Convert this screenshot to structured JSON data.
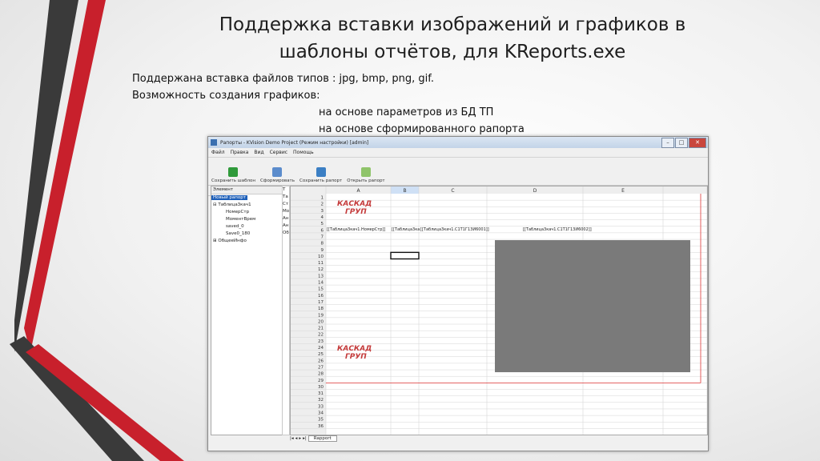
{
  "slide": {
    "title_line1": "Поддержка вставки изображений и графиков в",
    "title_line2": "шаблоны отчётов, для KReports.exe",
    "body_line1": "Поддержана вставка файлов типов : jpg, bmp, png, gif.",
    "body_line2": "Возможность создания графиков:",
    "body_line3": "на основе параметров из БД ТП",
    "body_line4": "на основе сформированного рапорта",
    "colors": {
      "accent_red": "#c8202c",
      "accent_gray": "#3a3a3a"
    }
  },
  "window": {
    "title": "Рапорты - KVision Demo Project (Режим настройки) [admin]",
    "controls": {
      "minimize": "–",
      "maximize": "□",
      "close": "✕"
    },
    "menu": [
      "Файл",
      "Правка",
      "Вид",
      "Сервис",
      "Помощь"
    ],
    "big_toolbar": [
      {
        "label": "Сохранить шаблон",
        "icon": "save-icon"
      },
      {
        "label": "Сформировать",
        "icon": "generate-icon"
      },
      {
        "label": "Сохранить рапорт",
        "icon": "save-report-icon"
      },
      {
        "label": "Открыть рапорт",
        "icon": "open-report-icon"
      }
    ],
    "tree_header": "Элемент",
    "tree_selected": "Новый рапорт",
    "tree_items": [
      "Таблица3кач1",
      "НомерСтр",
      "МоментВрем",
      "saved_0",
      "Save0_180",
      "ОбщееИнфо"
    ],
    "type_header": "Т",
    "type_items": [
      "Та",
      "Ст",
      "Мо",
      "Ан",
      "Ан",
      "Об"
    ],
    "columns": [
      "A",
      "B",
      "C",
      "D",
      "E"
    ],
    "row_numbers": [
      "1",
      "2",
      "3",
      "4",
      "5",
      "6",
      "7",
      "8",
      "9",
      "10",
      "11",
      "12",
      "13",
      "14",
      "15",
      "16",
      "17",
      "18",
      "19",
      "20",
      "21",
      "22",
      "23",
      "24",
      "25",
      "26",
      "27",
      "28",
      "29",
      "30",
      "31",
      "32",
      "33",
      "34",
      "35",
      "36"
    ],
    "row6_cells": [
      "[[Таблица3кач1.НомерСтр]]",
      "[[Таблица3ка",
      "[[Таблица3кач1.С1Т1Г13И6001]]",
      "[[Таблица3кач1.С1Т1Г13И6002]]"
    ],
    "logo_text_line1": "КАСКАД",
    "logo_text_line2": "ГРУП",
    "sheet_tab": "Rapport",
    "chart_placeholder_color": "#7a7a7a"
  }
}
